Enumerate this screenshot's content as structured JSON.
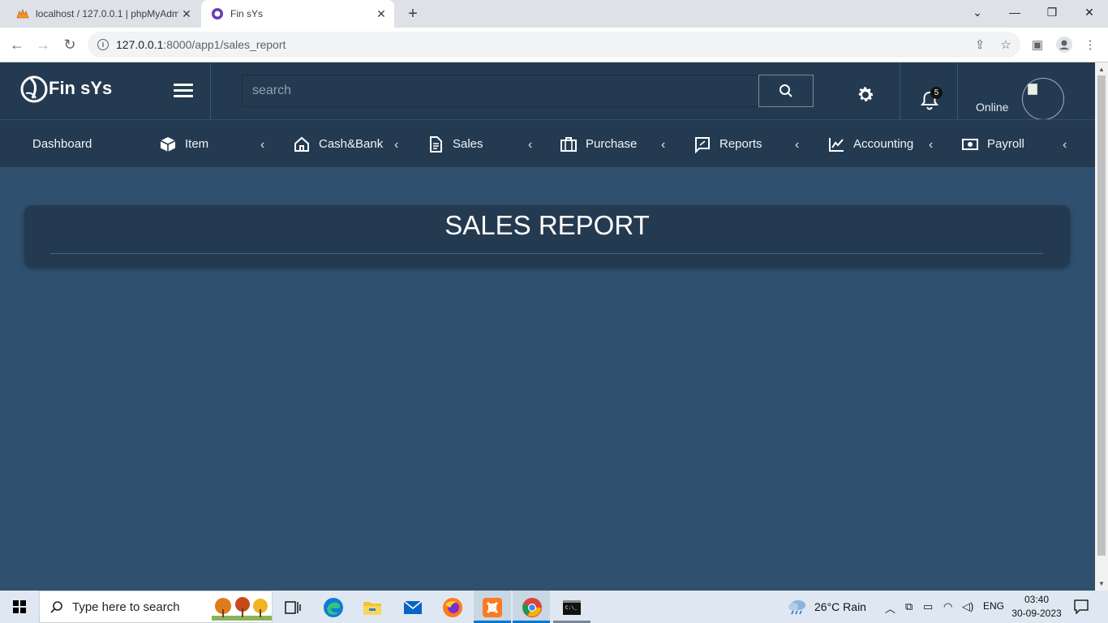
{
  "browser": {
    "tabs": [
      {
        "title": "localhost / 127.0.0.1 | phpMyAdmin",
        "icon": "phpmyadmin-icon"
      },
      {
        "title": "Fin sYs",
        "icon": "finsys-icon"
      }
    ],
    "url_host": "127.0.0.1",
    "url_path": ":8000/app1/sales_report"
  },
  "app": {
    "brand": "Fin sYs",
    "search_placeholder": "search",
    "notification_count": "5",
    "status": "Online"
  },
  "nav": {
    "dashboard": "Dashboard",
    "items": [
      {
        "label": "Item",
        "icon": "box-icon"
      },
      {
        "label": "Cash&Bank",
        "icon": "home-icon"
      },
      {
        "label": "Sales",
        "icon": "document-icon"
      },
      {
        "label": "Purchase",
        "icon": "briefcase-icon"
      },
      {
        "label": "Reports",
        "icon": "report-icon"
      },
      {
        "label": "Accounting",
        "icon": "chart-line-icon"
      },
      {
        "label": "Payroll",
        "icon": "money-icon"
      }
    ]
  },
  "page": {
    "title": "SALES REPORT"
  },
  "taskbar": {
    "search_placeholder": "Type here to search",
    "weather": "26°C  Rain",
    "language": "ENG",
    "time": "03:40",
    "date": "30-09-2023"
  },
  "colors": {
    "header_bg": "#243a51",
    "content_bg": "#2f506f"
  }
}
